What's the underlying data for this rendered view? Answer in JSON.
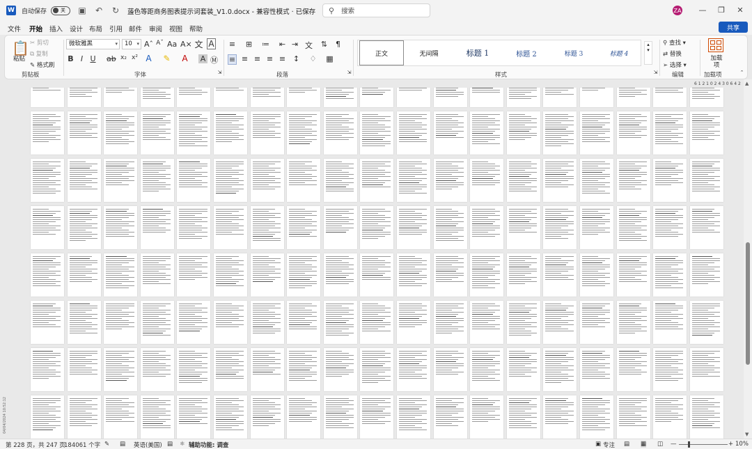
{
  "titlebar": {
    "autosave_label": "自动保存",
    "autosave_state": "关",
    "doc_title": "蓝色等距商务图表提示词套装_V1.0.docx",
    "compat": "兼容性模式 · 已保存",
    "search_placeholder": "搜索",
    "avatar_initials": "ZA"
  },
  "menu": {
    "tabs": [
      "文件",
      "开始",
      "插入",
      "设计",
      "布局",
      "引用",
      "邮件",
      "审阅",
      "视图",
      "帮助"
    ],
    "active": "开始",
    "share": "共享"
  },
  "ribbon": {
    "clipboard": {
      "paste": "粘贴",
      "cut": "剪切",
      "copy": "复制",
      "format_painter": "格式刷",
      "label": "剪贴板"
    },
    "font": {
      "family": "微软雅黑",
      "size": "10",
      "label": "字体"
    },
    "paragraph": {
      "label": "段落"
    },
    "styles": {
      "items": [
        "正文",
        "无间隔",
        "标题 1",
        "标题 2",
        "标题 3",
        "标题 4"
      ],
      "label": "样式"
    },
    "editing": {
      "find": "查找",
      "replace": "替换",
      "select": "选择",
      "label": "编辑"
    },
    "addins": {
      "button": "加载项",
      "label": "加载项"
    }
  },
  "ruler_text": "6 1 2 1 0 2 4 3 0 6 4 2",
  "side_text": "04/04/2024 10:52:12",
  "status": {
    "page": "第 228 页，共 247 页",
    "words": "184061 个字",
    "language": "英语(美国)",
    "accessibility": "辅助功能: 调查",
    "focus": "专注",
    "zoom": "10%",
    "zoom_level": 0.2
  },
  "colors": {
    "accent": "#185abd",
    "word_blue": "#185abd",
    "avatar": "#b51d73",
    "addin": "#d04a02"
  }
}
